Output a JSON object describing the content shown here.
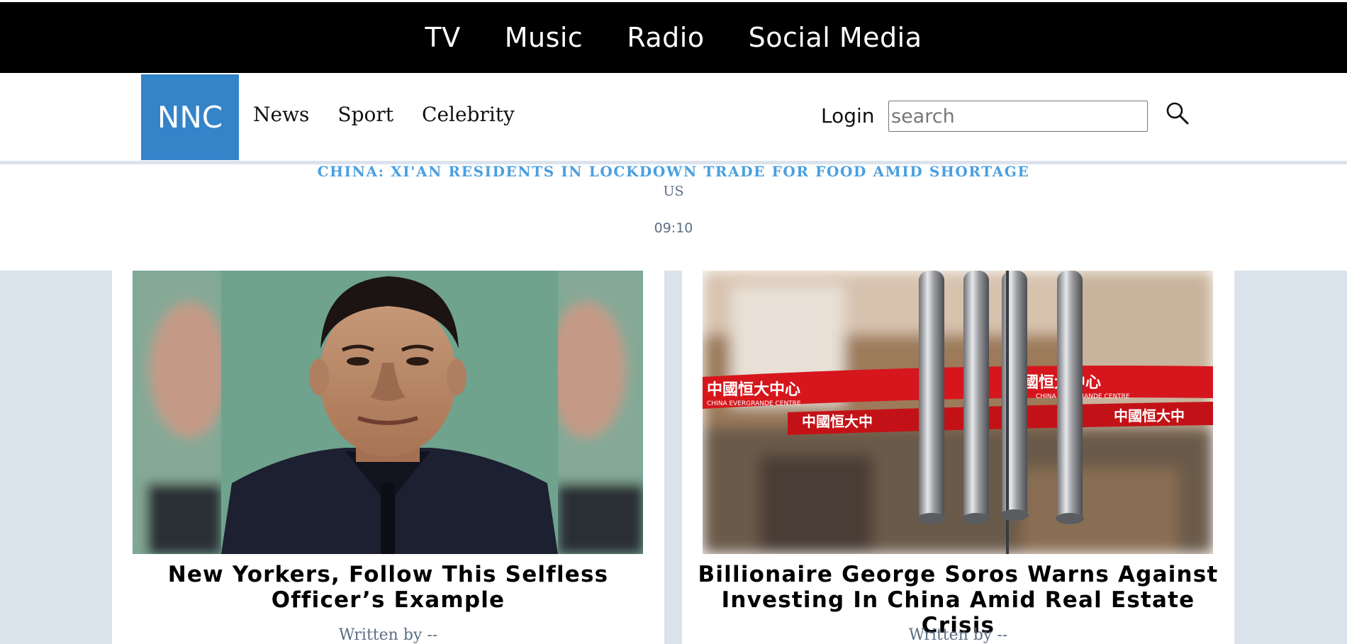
{
  "top_nav": {
    "items": [
      {
        "label": "TV"
      },
      {
        "label": "Music"
      },
      {
        "label": "Radio"
      },
      {
        "label": "Social Media"
      }
    ]
  },
  "main_nav": {
    "logo": "NNC",
    "links": [
      {
        "label": "News"
      },
      {
        "label": "Sport"
      },
      {
        "label": "Celebrity"
      }
    ],
    "login_label": "Login",
    "search_placeholder": "search",
    "search_icon": "magnifier-icon"
  },
  "ticker": {
    "headline": "CHINA: XI'AN RESIDENTS IN LOCKDOWN TRADE FOR FOOD AMID SHORTAGE",
    "region": "US",
    "time": "09:10"
  },
  "articles": [
    {
      "title": "New Yorkers, Follow This Selfless Officer’s Example",
      "author": "Written by --"
    },
    {
      "title": "Billionaire George Soros Warns Against Investing In China Amid Real Estate Crisis",
      "author": "Written by --"
    }
  ],
  "colors": {
    "logo_bg": "#3484c9",
    "ticker_headline": "#4a9fe0",
    "content_bg": "#dae3ec",
    "top_bar": "#000000"
  }
}
